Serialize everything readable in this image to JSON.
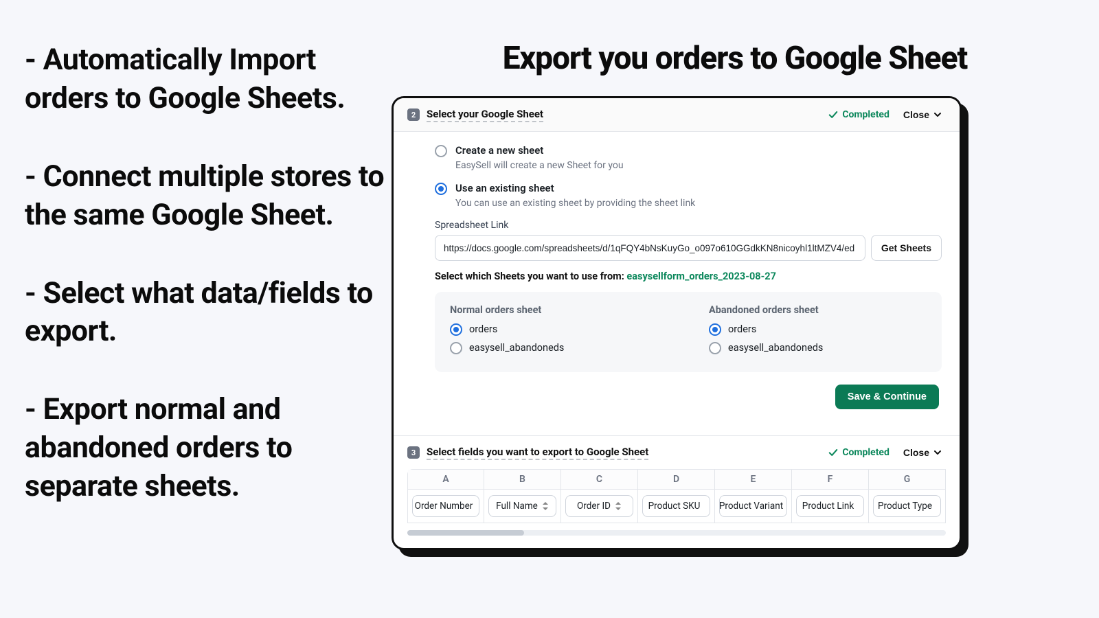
{
  "bullets": [
    "- Automatically Import orders to Google Sheets.",
    "- Connect multiple stores to the same Google Sheet.",
    "- Select what data/fields to export.",
    "- Export normal and abandoned orders to separate sheets."
  ],
  "headline": "Export you orders to Google Sheet",
  "step2": {
    "num": "2",
    "title": "Select your Google Sheet",
    "completed": "Completed",
    "close": "Close",
    "opt_create": {
      "label": "Create a new sheet",
      "sub": "EasySell will create a new Sheet for you"
    },
    "opt_existing": {
      "label": "Use an existing sheet",
      "sub": "You can use an existing sheet by providing the sheet link"
    },
    "link_label": "Spreadsheet Link",
    "link_value": "https://docs.google.com/spreadsheets/d/1qFQY4bNsKuyGo_o097o610GGdkKN8nicoyhl1ltMZV4/ed",
    "get_sheets": "Get Sheets",
    "select_prefix": "Select which Sheets you want to use from: ",
    "filename": "easysellform_orders_2023-08-27",
    "normal_title": "Normal orders sheet",
    "abandoned_title": "Abandoned orders sheet",
    "opt_orders": "orders",
    "opt_abandoneds": "easysell_abandoneds",
    "save": "Save & Continue"
  },
  "step3": {
    "num": "3",
    "title": "Select fields you want to export to Google Sheet",
    "completed": "Completed",
    "close": "Close",
    "columns": [
      "A",
      "B",
      "C",
      "D",
      "E",
      "F",
      "G"
    ],
    "fields": [
      "Order Number",
      "Full Name",
      "Order ID",
      "Product SKU",
      "Product Variant",
      "Product Link",
      "Product Type"
    ]
  }
}
